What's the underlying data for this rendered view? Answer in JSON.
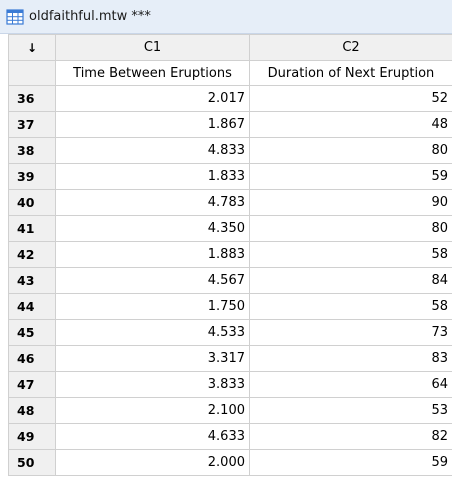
{
  "window": {
    "title": "oldfaithful.mtw ***",
    "icon": "worksheet-icon"
  },
  "sheet": {
    "corner_symbol": "↓",
    "columns": [
      {
        "id": "C1",
        "name": "Time Between Eruptions"
      },
      {
        "id": "C2",
        "name": "Duration of Next Eruption"
      }
    ],
    "rows": [
      {
        "num": "36",
        "c1": "2.017",
        "c2": "52"
      },
      {
        "num": "37",
        "c1": "1.867",
        "c2": "48"
      },
      {
        "num": "38",
        "c1": "4.833",
        "c2": "80"
      },
      {
        "num": "39",
        "c1": "1.833",
        "c2": "59"
      },
      {
        "num": "40",
        "c1": "4.783",
        "c2": "90"
      },
      {
        "num": "41",
        "c1": "4.350",
        "c2": "80"
      },
      {
        "num": "42",
        "c1": "1.883",
        "c2": "58"
      },
      {
        "num": "43",
        "c1": "4.567",
        "c2": "84"
      },
      {
        "num": "44",
        "c1": "1.750",
        "c2": "58"
      },
      {
        "num": "45",
        "c1": "4.533",
        "c2": "73"
      },
      {
        "num": "46",
        "c1": "3.317",
        "c2": "83"
      },
      {
        "num": "47",
        "c1": "3.833",
        "c2": "64"
      },
      {
        "num": "48",
        "c1": "2.100",
        "c2": "53"
      },
      {
        "num": "49",
        "c1": "4.633",
        "c2": "82"
      },
      {
        "num": "50",
        "c1": "2.000",
        "c2": "59"
      }
    ]
  }
}
